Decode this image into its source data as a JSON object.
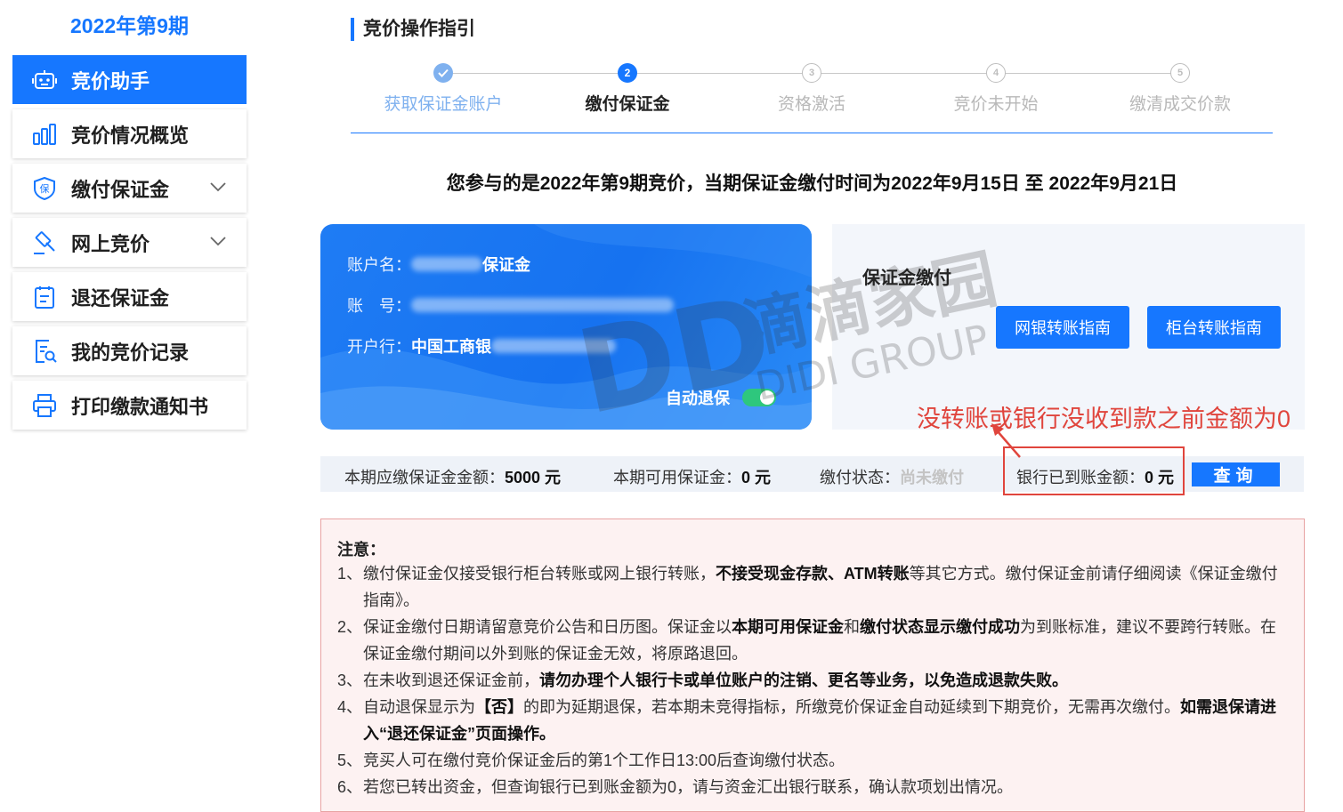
{
  "sidebar": {
    "period_title": "2022年第9期",
    "items": [
      {
        "label": "竞价助手",
        "icon": "robot-icon",
        "active": true
      },
      {
        "label": "竞价情况概览",
        "icon": "bar-chart-icon"
      },
      {
        "label": "缴付保证金",
        "icon": "shield-deposit-icon",
        "expandable": true
      },
      {
        "label": "网上竞价",
        "icon": "gavel-icon",
        "expandable": true
      },
      {
        "label": "退还保证金",
        "icon": "refund-document-icon"
      },
      {
        "label": "我的竞价记录",
        "icon": "record-search-icon"
      },
      {
        "label": "打印缴款通知书",
        "icon": "printer-icon"
      }
    ]
  },
  "guide": {
    "title": "竞价操作指引",
    "steps": [
      {
        "label": "获取保证金账户",
        "state": "done",
        "num": ""
      },
      {
        "label": "缴付保证金",
        "state": "current",
        "num": "2"
      },
      {
        "label": "资格激活",
        "state": "todo",
        "num": "3"
      },
      {
        "label": "竞价未开始",
        "state": "todo",
        "num": "4"
      },
      {
        "label": "缴清成交价款",
        "state": "todo",
        "num": "5"
      }
    ]
  },
  "notice_line": "您参与的是2022年第9期竞价，当期保证金缴付时间为2022年9月15日 至 2022年9月21日",
  "account_card": {
    "name_label": "账户名：",
    "name_value": "保证金",
    "number_label": "账　号：",
    "bank_label": "开户行：",
    "bank_value": "中国工商银",
    "auto_refund_label": "自动退保"
  },
  "payment_panel": {
    "title": "保证金缴付",
    "online_guide_button": "网银转账指南",
    "counter_guide_button": "柜台转账指南"
  },
  "watermark": {
    "text": "DD滴滴家园",
    "sub": "DIDI GROUP"
  },
  "status_bar": {
    "due_label": "本期应缴保证金金额：",
    "due_value": "5000 元",
    "available_label": "本期可用保证金：",
    "available_value": "0 元",
    "pay_status_label": "缴付状态：",
    "pay_status_value": "尚未缴付",
    "received_label": "银行已到账金额：",
    "received_value": "0 元",
    "query_button": "查询"
  },
  "annotation": "没转账或银行没收到款之前金额为0",
  "notes": {
    "title": "注意：",
    "items": [
      {
        "num": "1、",
        "parts": [
          {
            "t": "缴付保证金仅接受银行柜台转账或网上银行转账，"
          },
          {
            "t": "不接受现金存款、ATM转账",
            "b": true
          },
          {
            "t": "等其它方式。缴付保证金前请仔细阅读《保证金缴付指南》。"
          }
        ]
      },
      {
        "num": "2、",
        "parts": [
          {
            "t": "保证金缴付日期请留意竞价公告和日历图。保证金以"
          },
          {
            "t": "本期可用保证金",
            "b": true
          },
          {
            "t": "和"
          },
          {
            "t": "缴付状态显示缴付成功",
            "b": true
          },
          {
            "t": "为到账标准，建议不要跨行转账。在保证金缴付期间以外到账的保证金无效，将原路退回。"
          }
        ]
      },
      {
        "num": "3、",
        "parts": [
          {
            "t": "在未收到退还保证金前，"
          },
          {
            "t": "请勿办理个人银行卡或单位账户的注销、更名等业务，以免造成退款失败。",
            "b": true
          }
        ]
      },
      {
        "num": "4、",
        "parts": [
          {
            "t": "自动退保显示为"
          },
          {
            "t": "【否】",
            "b": true
          },
          {
            "t": "的即为延期退保，若本期未竞得指标，所缴竞价保证金自动延续到下期竞价，无需再次缴付。"
          },
          {
            "t": "如需退保请进入“退还保证金”页面操作。",
            "b": true
          }
        ]
      },
      {
        "num": "5、",
        "parts": [
          {
            "t": "竞买人可在缴付竞价保证金后的第1个工作日13:00后查询缴付状态。"
          }
        ]
      },
      {
        "num": "6、",
        "parts": [
          {
            "t": "若您已转出资金，但查询银行已到账金额为0，请与资金汇出银行联系，确认款项划出情况。"
          }
        ]
      }
    ]
  },
  "colors": {
    "primary": "#1677ff",
    "annotation_red": "#e0453d",
    "success_green": "#2ec77d",
    "notes_bg": "#fdf2f2"
  }
}
